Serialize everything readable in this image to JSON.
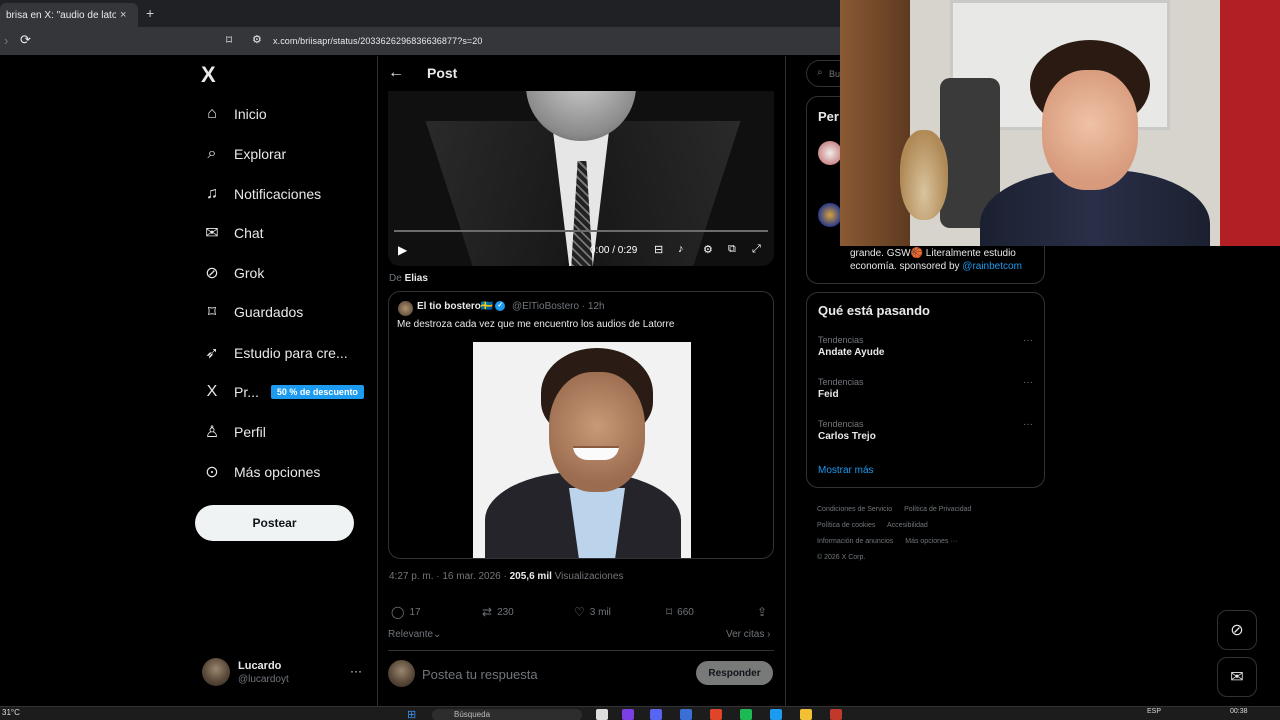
{
  "browser": {
    "tab_title": "brisa en X: \"audio de latorre",
    "tab_close": "×",
    "new_tab": "+",
    "url": "x.com/briisapr/status/2033626296836636877?s=20"
  },
  "sidebar": {
    "logo": "X",
    "items": [
      {
        "label": "Inicio",
        "icon": "home-icon"
      },
      {
        "label": "Explorar",
        "icon": "search-icon"
      },
      {
        "label": "Notificaciones",
        "icon": "bell-icon"
      },
      {
        "label": "Chat",
        "icon": "mail-icon"
      },
      {
        "label": "Grok",
        "icon": "grok-icon"
      },
      {
        "label": "Guardados",
        "icon": "bookmark-icon"
      },
      {
        "label": "Estudio para cre...",
        "icon": "rocket-icon"
      },
      {
        "label": "Pr...",
        "icon": "x-premium-icon",
        "badge": "50 % de descuento"
      },
      {
        "label": "Perfil",
        "icon": "user-icon"
      },
      {
        "label": "Más opciones",
        "icon": "more-circle-icon"
      }
    ],
    "post_button": "Postear",
    "account": {
      "name": "Lucardo",
      "handle": "@lucardoyt",
      "more": "···"
    }
  },
  "header": {
    "back": "←",
    "title": "Post"
  },
  "video": {
    "time": "0:00 / 0:29",
    "progress": 0
  },
  "quote": {
    "from_prefix": "De",
    "from_name": "Elias",
    "author_name": "El tio bostero🇸🇪",
    "author_handle": "@ElTioBostero · 12h",
    "text": "Me destroza cada vez que me encuentro los audios de Latorre"
  },
  "post_meta": {
    "time": "4:27 p. m. · 16 mar. 2026 · ",
    "views_count": "205,6 mil",
    "views_label": " Visualizaciones"
  },
  "actions": {
    "replies": "17",
    "reposts": "230",
    "likes": "3 mil",
    "bookmarks": "660"
  },
  "sort": {
    "relevante": "Relevante⌄",
    "ver_citas": "Ver citas ›"
  },
  "reply": {
    "placeholder": "Postea tu respuesta",
    "button": "Responder"
  },
  "right": {
    "search_placeholder": "Bu",
    "people_title": "Per",
    "people_bio": "grande. GSW🏀 Literalmente estudio economía. sponsored by ",
    "people_bio_link": "@rainbetcom",
    "trends_title": "Qué está pasando",
    "trends": [
      {
        "category": "Tendencias",
        "name": "Andate Ayude"
      },
      {
        "category": "Tendencias",
        "name": "Feid"
      },
      {
        "category": "Tendencias",
        "name": "Carlos Trejo"
      }
    ],
    "show_more": "Mostrar más",
    "footer": [
      "Condiciones de Servicio",
      "Política de Privacidad",
      "Política de cookies",
      "Accesibilidad",
      "Información de anuncios",
      "Más opciones ···",
      "© 2026 X Corp."
    ]
  },
  "taskbar": {
    "temp": "31°C",
    "search": "Búsqueda",
    "lang": "ESP",
    "clock": "00:38"
  },
  "colors": {
    "accent": "#1d9bf0",
    "background": "#000000",
    "border": "#2f3336",
    "muted": "#71767b"
  }
}
